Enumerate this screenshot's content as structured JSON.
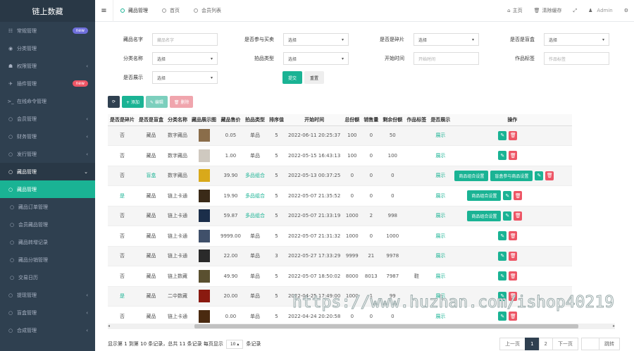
{
  "brand": "链上数藏",
  "sidebar": {
    "items": [
      {
        "icon": "☷",
        "label": "常规管理",
        "badge": "new",
        "badge_color": "#6f6fdb"
      },
      {
        "icon": "◉",
        "label": "分类管理"
      },
      {
        "icon": "☗",
        "label": "权限管理",
        "chevron": "‹"
      },
      {
        "icon": "✈",
        "label": "插件管理",
        "badge": "new",
        "badge_color": "#ed5565"
      },
      {
        "icon": ">_",
        "label": "在线命令管理"
      },
      {
        "icon": "○",
        "label": "会员管理",
        "chevron": "‹"
      },
      {
        "icon": "○",
        "label": "财务管理",
        "chevron": "‹"
      },
      {
        "icon": "○",
        "label": "发行管理",
        "chevron": "‹"
      },
      {
        "icon": "○",
        "label": "藏品管理",
        "chevron": "⌄",
        "state": "open"
      },
      {
        "icon": "○",
        "label": "藏品管理",
        "state": "active"
      },
      {
        "icon": "○",
        "label": "藏品订单管理",
        "sub": true
      },
      {
        "icon": "○",
        "label": "会员藏品管理",
        "sub": true
      },
      {
        "icon": "○",
        "label": "藏品转增记录",
        "sub": true
      },
      {
        "icon": "○",
        "label": "藏品分销管理",
        "sub": true
      },
      {
        "icon": "○",
        "label": "交易日历",
        "sub": true
      },
      {
        "icon": "○",
        "label": "提现管理",
        "chevron": "‹"
      },
      {
        "icon": "○",
        "label": "盲盒管理",
        "chevron": "‹"
      },
      {
        "icon": "○",
        "label": "合成管理",
        "chevron": "‹"
      }
    ]
  },
  "topbar": {
    "tabs": [
      {
        "label": "藏品管理",
        "active": true
      },
      {
        "label": "首页"
      },
      {
        "label": "会员列表"
      }
    ],
    "home": "主页",
    "clear_cache": "清除缓存",
    "user": "Admin"
  },
  "filters": {
    "name_label": "藏品名字",
    "name_placeholder": "藏品名字",
    "lottery_label": "是否参与买卖",
    "lottery_value": "选择",
    "fragment_label": "是否是碎片",
    "fragment_value": "选择",
    "blindbox_label": "是否是盲盒",
    "blindbox_value": "选择",
    "category_label": "分类名称",
    "category_value": "选择",
    "auction_label": "拍品类型",
    "auction_value": "选择",
    "start_label": "开始时间",
    "start_placeholder": "开始时间",
    "tag_label": "作品标签",
    "tag_placeholder": "作品标签",
    "show_label": "是否展示",
    "show_value": "选择",
    "submit": "提交",
    "reset": "重置"
  },
  "toolbar": {
    "refresh": "⟳",
    "add": "+ 添加",
    "edit": "✎ 编辑",
    "delete": "🗑 删除"
  },
  "table": {
    "headers": [
      "是否是碎片",
      "是否是盲盒",
      "分类名称",
      "藏品展示图",
      "藏品售价",
      "拍品类型",
      "排序值",
      "开始时间",
      "总份额",
      "销售量",
      "剩余份额",
      "作品标签",
      "是否展示",
      "操作"
    ],
    "rows": [
      {
        "frag": "否",
        "box": "藏品",
        "cat": "数字藏品",
        "price": "0.05",
        "type": "单品",
        "sort": "5",
        "start": "2022-06-11 20:25:37",
        "total": "100",
        "sold": "0",
        "left": "50",
        "tag": "",
        "show": "展示",
        "ops": [],
        "thumb": "#8a6d4a"
      },
      {
        "frag": "否",
        "box": "藏品",
        "cat": "数字藏品",
        "price": "1.00",
        "type": "单品",
        "sort": "5",
        "start": "2022-05-15 16:43:13",
        "total": "100",
        "sold": "0",
        "left": "100",
        "tag": "",
        "show": "展示",
        "ops": [],
        "thumb": "#cfc9c0"
      },
      {
        "frag": "否",
        "box": "盲盒",
        "cat": "数字藏品",
        "price": "39.90",
        "type": "多品组合",
        "sort": "5",
        "start": "2022-05-13 00:37:25",
        "total": "0",
        "sold": "0",
        "left": "0",
        "tag": "",
        "show": "展示",
        "ops": [
          "商品组合设置",
          "盲盒参与商品设置"
        ],
        "thumb": "#d9a91a"
      },
      {
        "frag": "是",
        "box": "藏品",
        "cat": "链上卡通",
        "price": "19.90",
        "type": "多品组合",
        "sort": "5",
        "start": "2022-05-07 21:35:52",
        "total": "0",
        "sold": "0",
        "left": "0",
        "tag": "",
        "show": "展示",
        "ops": [
          "商品组合设置"
        ],
        "thumb": "#3a2a18"
      },
      {
        "frag": "否",
        "box": "藏品",
        "cat": "链上卡通",
        "price": "59.87",
        "type": "多品组合",
        "sort": "5",
        "start": "2022-05-07 21:33:19",
        "total": "1000",
        "sold": "2",
        "left": "998",
        "tag": "",
        "show": "展示",
        "ops": [
          "商品组合设置"
        ],
        "thumb": "#1b2e4a"
      },
      {
        "frag": "否",
        "box": "藏品",
        "cat": "链上卡通",
        "price": "9999.00",
        "type": "单品",
        "sort": "5",
        "start": "2022-05-07 21:31:32",
        "total": "1000",
        "sold": "0",
        "left": "1000",
        "tag": "",
        "show": "展示",
        "ops": [],
        "thumb": "#40506a"
      },
      {
        "frag": "否",
        "box": "藏品",
        "cat": "链上卡通",
        "price": "22.00",
        "type": "单品",
        "sort": "3",
        "start": "2022-05-27 17:33:29",
        "total": "9999",
        "sold": "21",
        "left": "9978",
        "tag": "",
        "show": "展示",
        "ops": [],
        "thumb": "#2a2a2a"
      },
      {
        "frag": "否",
        "box": "藏品",
        "cat": "链上数藏",
        "price": "49.90",
        "type": "单品",
        "sort": "5",
        "start": "2022-05-07 18:50:02",
        "total": "8000",
        "sold": "8013",
        "left": "7987",
        "tag": "鞋",
        "show": "展示",
        "ops": [],
        "thumb": "#5a5030"
      },
      {
        "frag": "是",
        "box": "藏品",
        "cat": "二中数藏",
        "price": "20.00",
        "type": "单品",
        "sort": "5",
        "start": "2022-04-25 17:49:00",
        "total": "1000",
        "sold": "1",
        "left": "99",
        "tag": "",
        "show": "展示",
        "ops": [],
        "thumb": "#8a1a10"
      },
      {
        "frag": "否",
        "box": "藏品",
        "cat": "链上卡通",
        "price": "0.00",
        "type": "单品",
        "sort": "5",
        "start": "2022-04-24 20:20:58",
        "total": "0",
        "sold": "0",
        "left": "0",
        "tag": "",
        "show": "展示",
        "ops": [],
        "thumb": "#4a2a10"
      }
    ]
  },
  "footer": {
    "summary": "显示第 1 到第 10 条记录，总共 11 条记录 每页显示",
    "per_page": "10 ▴",
    "suffix": "条记录",
    "prev": "上一页",
    "pages": [
      "1",
      "2"
    ],
    "next": "下一页",
    "jump": "跳转"
  },
  "colors": {
    "accent": "#1ab394",
    "danger": "#ed5565",
    "sidebar": "#2f4050",
    "edit_disabled": "#7ccfbd",
    "delete_disabled": "#f0a5ad"
  },
  "watermark": "https://www.huzhan.com/ishop40219"
}
